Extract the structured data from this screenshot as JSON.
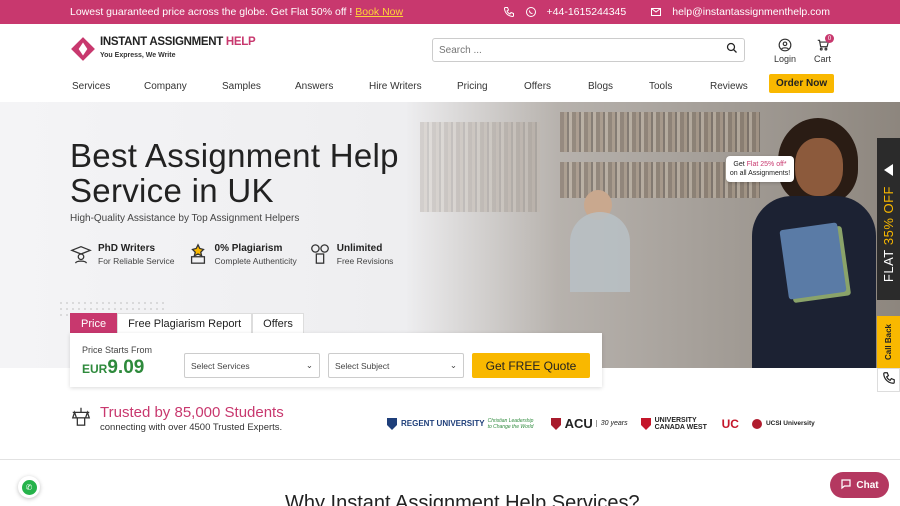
{
  "topbar": {
    "promo_text": "Lowest guaranteed price across the globe. Get Flat 50% off !",
    "promo_link": "Book Now",
    "phone": "+44-1615244345",
    "email": "help@instantassignmenthelp.com"
  },
  "header": {
    "brand_part1": "INSTANT ASSIGNMENT",
    "brand_part2": "HELP",
    "tagline": "You Express, We Write",
    "search_placeholder": "Search ...",
    "login_label": "Login",
    "cart_label": "Cart",
    "cart_count": "0"
  },
  "nav": {
    "items": [
      "Services",
      "Company",
      "Samples",
      "Answers",
      "Hire Writers",
      "Pricing",
      "Offers",
      "Blogs",
      "Tools",
      "Reviews"
    ],
    "order_now": "Order Now"
  },
  "hero": {
    "title_line1": "Best Assignment Help",
    "title_line2": "Service in UK",
    "subtitle": "High-Quality Assistance by Top Assignment Helpers",
    "features": [
      {
        "title": "PhD Writers",
        "desc": "For Reliable Service",
        "icon": "graduate-icon"
      },
      {
        "title": "0% Plagiarism",
        "desc": "Complete Authenticity",
        "icon": "award-icon"
      },
      {
        "title": "Unlimited",
        "desc": "Free Revisions",
        "icon": "revision-icon"
      }
    ],
    "bubble_pre": "Get",
    "bubble_highlight": "Flat 25% off*",
    "bubble_post": "on all Assignments!"
  },
  "quote": {
    "tabs": [
      "Price",
      "Free Plagiarism Report",
      "Offers"
    ],
    "price_label": "Price Starts From",
    "currency": "EUR",
    "price": "9.09",
    "select_services": "Select Services",
    "select_subject": "Select Subject",
    "button": "Get FREE Quote"
  },
  "trust": {
    "title": "Trusted by 85,000 Students",
    "subtitle": "connecting with over 4500 Trusted Experts.",
    "universities": [
      "REGENT UNIVERSITY",
      "Christian Leadership to Change the World",
      "ACU",
      "30 years",
      "UNIVERSITY CANADA WEST",
      "UC",
      "UCSI University"
    ]
  },
  "section_title": "Why Instant Assignment Help Services?",
  "side": {
    "offer_prefix": "FLAT",
    "offer_value": "35% OFF",
    "callback": "Call Back"
  },
  "chat_label": "Chat",
  "colors": {
    "brand": "#c8386e",
    "accent": "#f9b800",
    "price_green": "#2e8a3c"
  }
}
